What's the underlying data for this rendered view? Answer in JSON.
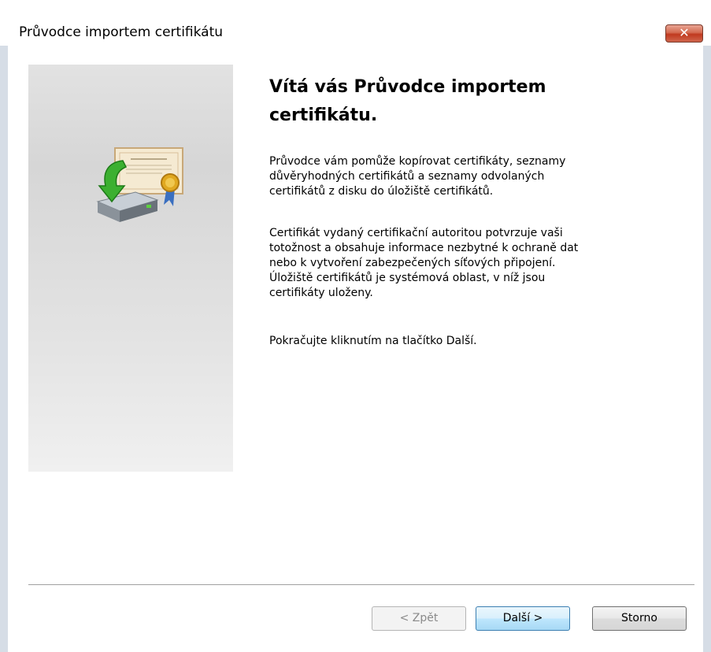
{
  "window": {
    "title": "Průvodce importem certifikátu",
    "close_label": "✕"
  },
  "icons": {
    "wizard": "certificate-import-icon",
    "close": "close-icon"
  },
  "main": {
    "heading": "Vítá vás Průvodce importem certifikátu.",
    "paragraph1": "Průvodce vám pomůže kopírovat certifikáty, seznamy\ndůvěryhodných certifikátů a seznamy odvolaných\ncertifikátů z disku do úložiště certifikátů.",
    "paragraph2": "Certifikát vydaný certifikační autoritou potvrzuje vaši\ntotožnost a obsahuje informace nezbytné k ochraně dat\nnebo k vytvoření zabezpečených síťových připojení.\nÚložiště certifikátů je systémová oblast, v níž jsou\ncertifikáty uloženy.",
    "paragraph3": "Pokračujte kliknutím na tlačítko Další."
  },
  "buttons": {
    "back": "< Zpět",
    "next": "Další >",
    "cancel": "Storno"
  },
  "colors": {
    "close_button": "#c0391e",
    "default_button_border": "#3c7fb1",
    "frame": "#d6dde6"
  }
}
